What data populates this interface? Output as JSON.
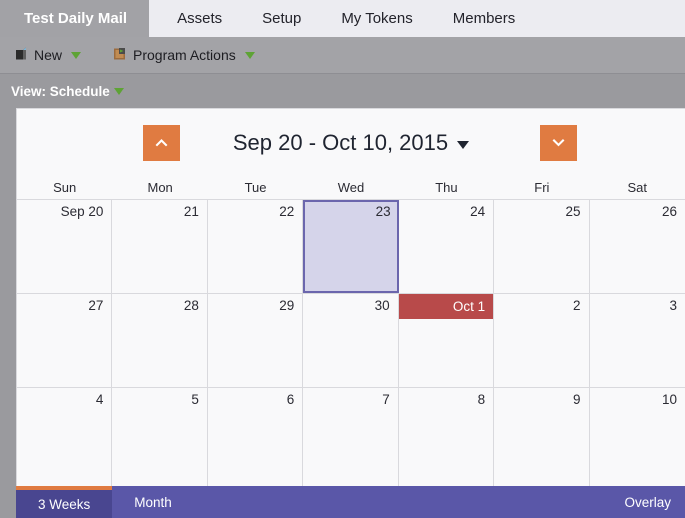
{
  "navbar": {
    "active_tab": "Test Daily Mail",
    "tabs": [
      {
        "label": "Assets"
      },
      {
        "label": "Setup"
      },
      {
        "label": "My Tokens"
      },
      {
        "label": "Members"
      }
    ]
  },
  "toolbar": {
    "items": [
      {
        "label": "New",
        "icon": "new-document-icon",
        "caret": "dropdown-caret"
      },
      {
        "label": "Program Actions",
        "icon": "program-actions-icon",
        "caret": "dropdown-caret"
      }
    ]
  },
  "viewbar": {
    "label": "View: Schedule",
    "caret": "dropdown-caret"
  },
  "calendar": {
    "title": "Sep 20 - Oct 10, 2015",
    "prev_icon": "chevron-up-icon",
    "next_icon": "chevron-down-icon",
    "title_caret": "chevron-down-icon",
    "accent_orange": "#e07b41",
    "selected_bg": "#d5d4ea",
    "selected_border": "#6b66ad",
    "month_marker_bg": "#b84a4a",
    "dow": [
      "Sun",
      "Mon",
      "Tue",
      "Wed",
      "Thu",
      "Fri",
      "Sat"
    ],
    "weeks": [
      [
        {
          "num": "Sep 20"
        },
        {
          "num": "21"
        },
        {
          "num": "22"
        },
        {
          "num": "23",
          "selected": true
        },
        {
          "num": "24"
        },
        {
          "num": "25"
        },
        {
          "num": "26"
        }
      ],
      [
        {
          "num": "27"
        },
        {
          "num": "28"
        },
        {
          "num": "29"
        },
        {
          "num": "30"
        },
        {
          "num": "",
          "month_marker": "Oct 1"
        },
        {
          "num": "2"
        },
        {
          "num": "3"
        }
      ],
      [
        {
          "num": "4"
        },
        {
          "num": "5"
        },
        {
          "num": "6"
        },
        {
          "num": "7"
        },
        {
          "num": "8"
        },
        {
          "num": "9"
        },
        {
          "num": "10"
        }
      ]
    ]
  },
  "bottombar": {
    "bg": "#5a57a8",
    "active_bg": "#494690",
    "tabs": [
      {
        "label": "3 Weeks",
        "active": true
      },
      {
        "label": "Month",
        "active": false
      }
    ],
    "right_label": "Overlay"
  }
}
